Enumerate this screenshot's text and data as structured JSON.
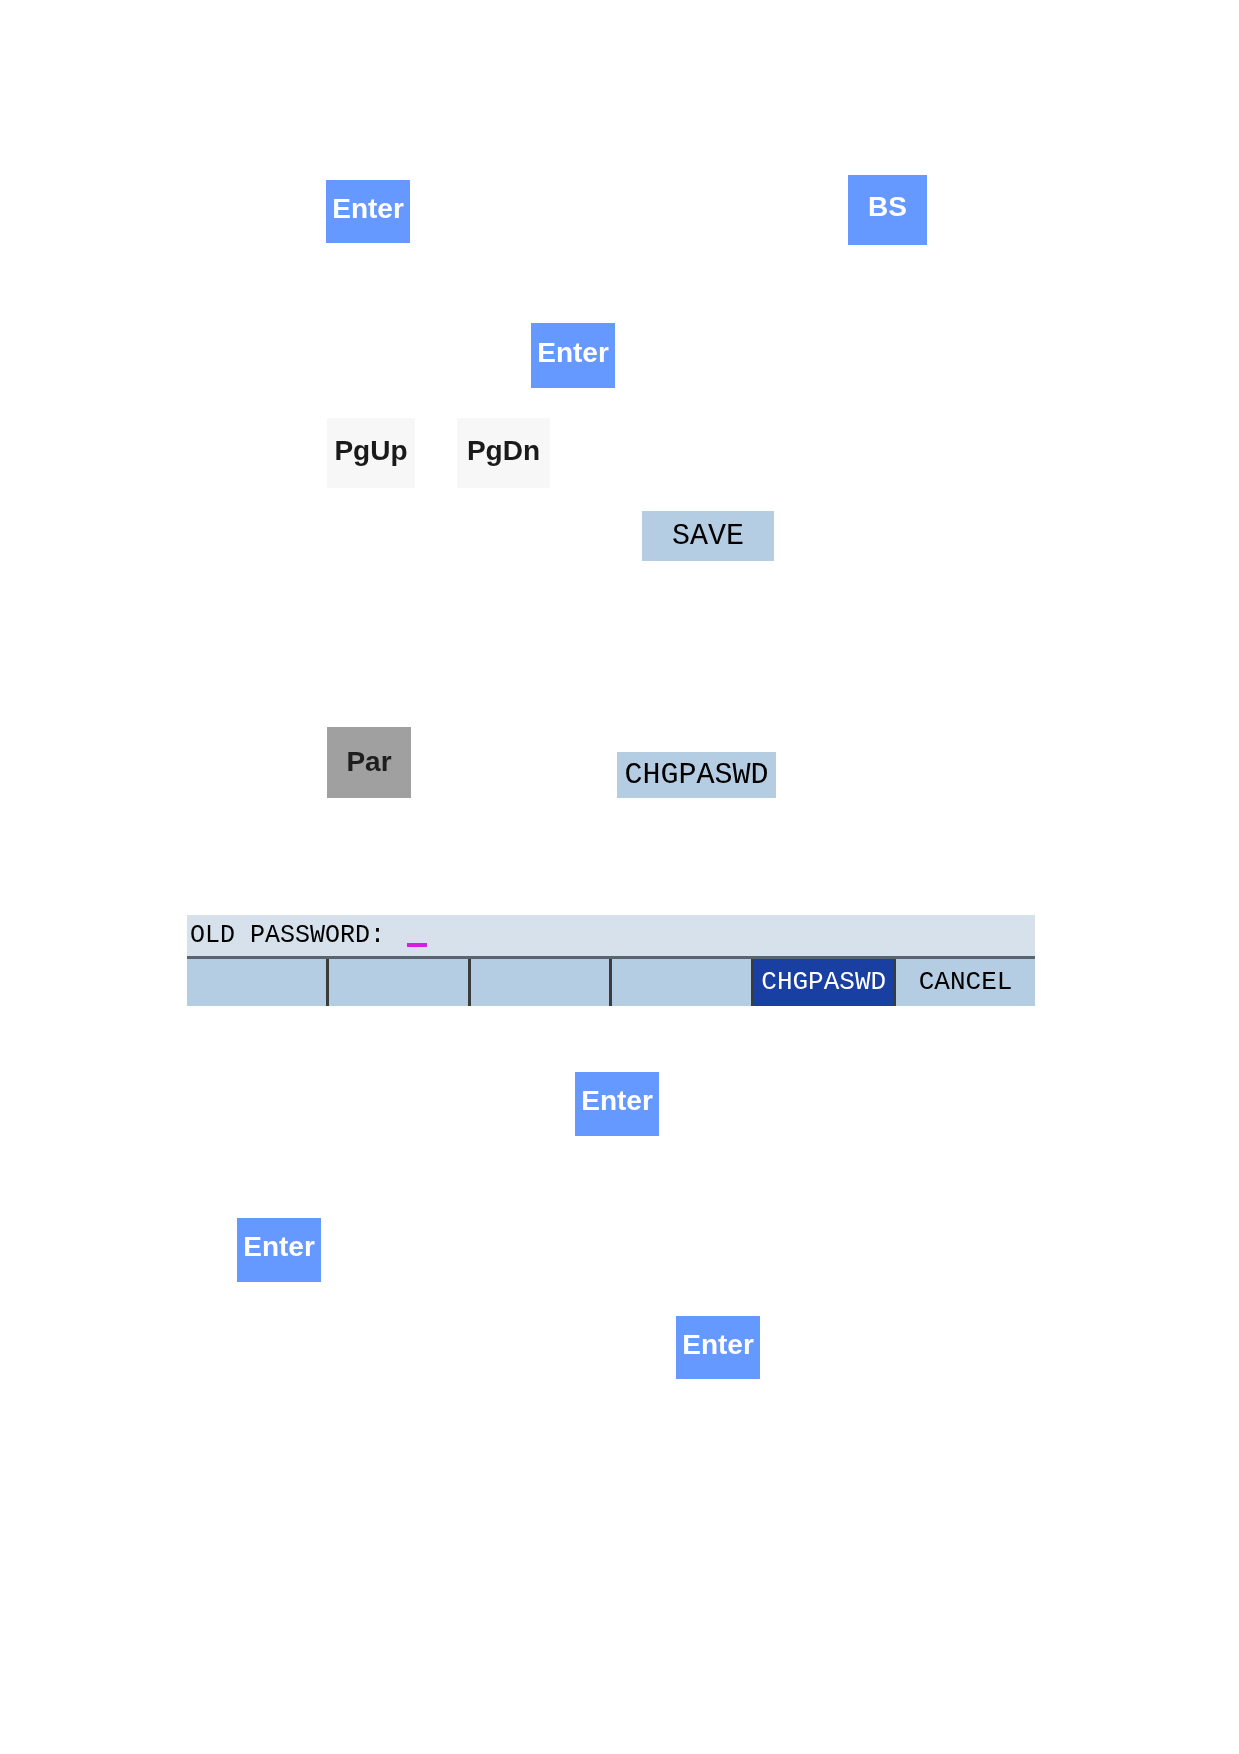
{
  "items": [
    {
      "kind": "blue_key",
      "label": "Enter"
    },
    {
      "kind": "blue_key",
      "label": "BS"
    },
    {
      "kind": "blue_key",
      "label": "Enter"
    },
    {
      "kind": "plain_key",
      "label": "PgUp"
    },
    {
      "kind": "plain_key",
      "label": "PgDn"
    },
    {
      "kind": "softkey",
      "label": "SAVE"
    },
    {
      "kind": "gray_key",
      "label": "Par"
    },
    {
      "kind": "softkey",
      "label": "CHGPASWD"
    },
    {
      "kind": "prompt_panel",
      "prompt": "OLD PASSWORD:",
      "cursor": true,
      "softkeys": [
        {
          "selected": false
        },
        {
          "selected": false
        },
        {
          "selected": false
        },
        {
          "selected": false
        },
        {
          "label": "CHGPASWD",
          "selected": true
        },
        {
          "label": "CANCEL",
          "selected": false
        }
      ]
    },
    {
      "kind": "blue_key",
      "label": "Enter"
    },
    {
      "kind": "blue_key",
      "label": "Enter"
    },
    {
      "kind": "blue_key",
      "label": "Enter"
    }
  ]
}
